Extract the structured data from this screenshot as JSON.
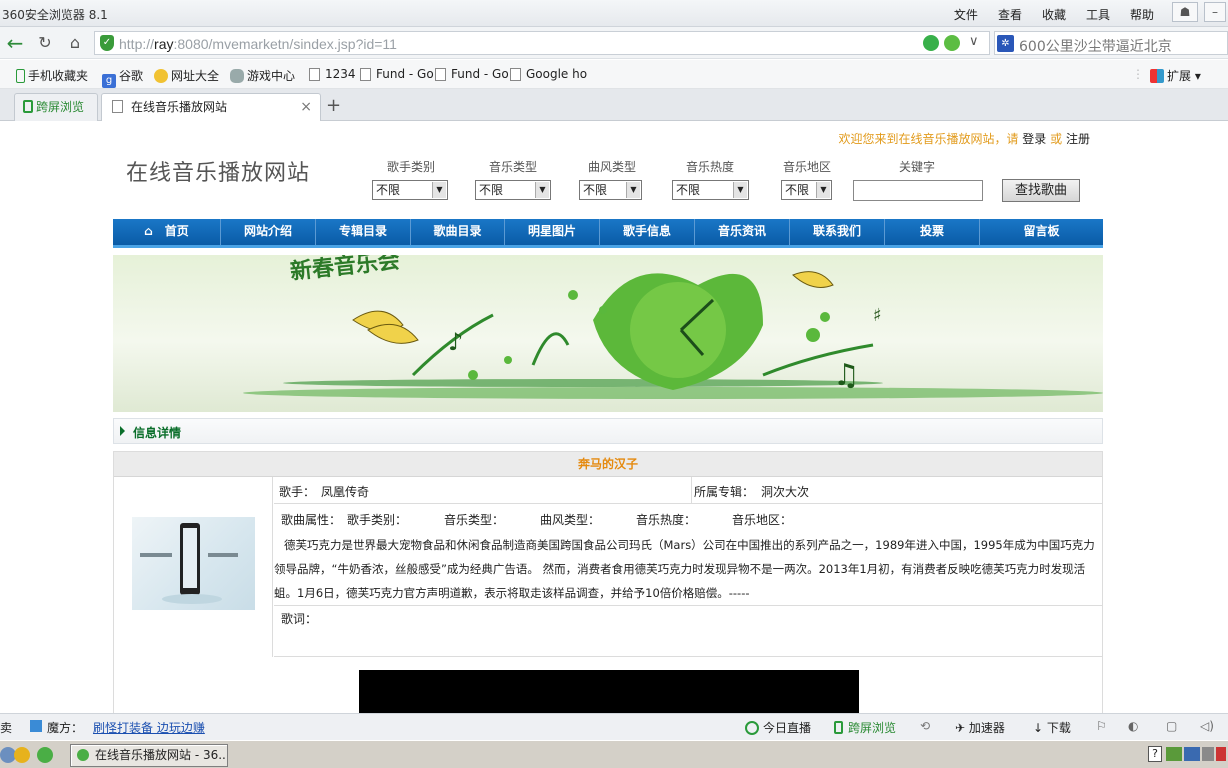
{
  "window": {
    "title": "360安全浏览器 8.1",
    "menu": [
      "文件",
      "查看",
      "收藏",
      "工具",
      "帮助"
    ]
  },
  "address": {
    "url_prefix": "http://",
    "url_host": "ray",
    "url_rest": ":8080/mvemarketn/sindex.jsp?id=11",
    "search_text": "600公里沙尘带逼近北京"
  },
  "bookmarks": [
    {
      "label": "手机收藏夹",
      "icon": "phone-icon"
    },
    {
      "label": "谷歌",
      "icon": "google-icon"
    },
    {
      "label": "网址大全",
      "icon": "sites-icon"
    },
    {
      "label": "游戏中心",
      "icon": "gamepad-icon"
    },
    {
      "label": "1234",
      "icon": "page-icon"
    },
    {
      "label": "Fund - Go",
      "icon": "page-icon"
    },
    {
      "label": "Fund - Go",
      "icon": "page-icon"
    },
    {
      "label": "Google ho",
      "icon": "page-icon"
    }
  ],
  "bookmarks_extend": "扩展",
  "tabs": [
    {
      "label": "跨屏浏览"
    },
    {
      "label": "在线音乐播放网站"
    }
  ],
  "page": {
    "welcome_prefix": "欢迎您来到在线音乐播放网站，请",
    "login": "登录",
    "or": "或",
    "register": "注册",
    "site_title": "在线音乐播放网站",
    "filters": [
      {
        "label": "歌手类别",
        "value": "不限"
      },
      {
        "label": "音乐类型",
        "value": "不限"
      },
      {
        "label": "曲风类型",
        "value": "不限"
      },
      {
        "label": "音乐热度",
        "value": "不限"
      },
      {
        "label": "音乐地区",
        "value": "不限"
      }
    ],
    "keyword_label": "关键字",
    "keyword_value": "",
    "search_button": "查找歌曲",
    "nav": [
      "首页",
      "网站介绍",
      "专辑目录",
      "歌曲目录",
      "明星图片",
      "歌手信息",
      "音乐资讯",
      "联系我们",
      "投票",
      "留言板"
    ],
    "banner_title": "新春音乐会",
    "info_header": "信息详情",
    "song_title": "奔马的汉子",
    "singer_label": "歌手：",
    "singer": "凤凰传奇",
    "album_label": "所属专辑：",
    "album": "洞次大次",
    "attr_label": "歌曲属性：",
    "attrs": [
      "歌手类别：",
      "音乐类型：",
      "曲风类型：",
      "音乐热度：",
      "音乐地区："
    ],
    "description": "德芙巧克力是世界最大宠物食品和休闲食品制造商美国跨国食品公司玛氏（Mars）公司在中国推出的系列产品之一，1989年进入中国，1995年成为中国巧克力领导品牌，“牛奶香浓，丝般感受”成为经典广告语。 然而，消费者食用德芙巧克力时发现异物不是一两次。2013年1月初，有消费者反映吃德芙巧克力时发现活蛆。1月6日，德芙巧克力官方声明道歉，表示将取走该样品调查，并给予10倍价格赔偿。-----",
    "lyrics_label": "歌词："
  },
  "statusbar": {
    "left_cut": "卖",
    "magic_label": "魔方：",
    "magic_link": "刷怪打装备 边玩边赚",
    "live": "今日直播",
    "cross": "跨屏浏览",
    "accelerator": "加速器",
    "download": "下载"
  },
  "taskbar": {
    "task": "在线音乐播放网站 - 36..."
  }
}
